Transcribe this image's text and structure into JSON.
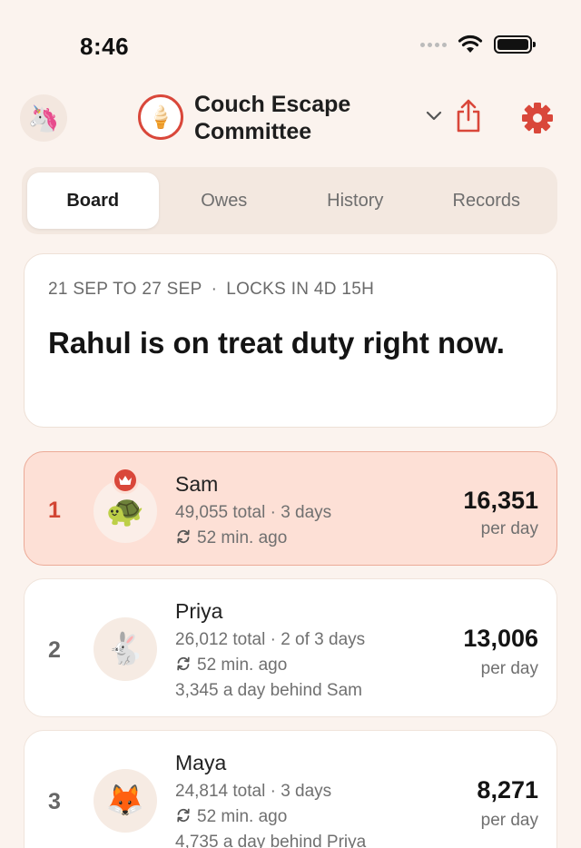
{
  "status_bar": {
    "time": "8:46"
  },
  "header": {
    "user_avatar": "unicorn",
    "group_icon": "ice-cream",
    "group_name": "Couch Escape Committee"
  },
  "tabs": [
    {
      "label": "Board",
      "active": true
    },
    {
      "label": "Owes",
      "active": false
    },
    {
      "label": "History",
      "active": false
    },
    {
      "label": "Records",
      "active": false
    }
  ],
  "period": {
    "range": "21 SEP TO 27 SEP",
    "separator": "·",
    "lock": "LOCKS IN 4D 15H",
    "headline": "Rahul is on treat duty right now."
  },
  "leaderboard": [
    {
      "rank": "1",
      "name": "Sam",
      "emoji": "🐢",
      "summary": "49,055 total · 3 days",
      "updated": "52 min. ago",
      "score": "16,351",
      "unit": "per day",
      "leader": true
    },
    {
      "rank": "2",
      "name": "Priya",
      "emoji": "🐇",
      "summary": "26,012 total · 2 of 3 days",
      "updated": "52 min. ago",
      "behind": "3,345 a day behind Sam",
      "score": "13,006",
      "unit": "per day"
    },
    {
      "rank": "3",
      "name": "Maya",
      "emoji": "🦊",
      "summary": "24,814 total · 3 days",
      "updated": "52 min. ago",
      "behind": "4,735 a day behind Priya",
      "score": "8,271",
      "unit": "per day"
    }
  ],
  "colors": {
    "accent": "#d9473a",
    "background": "#fbf3ee",
    "leader_bg": "#fde0d6"
  }
}
